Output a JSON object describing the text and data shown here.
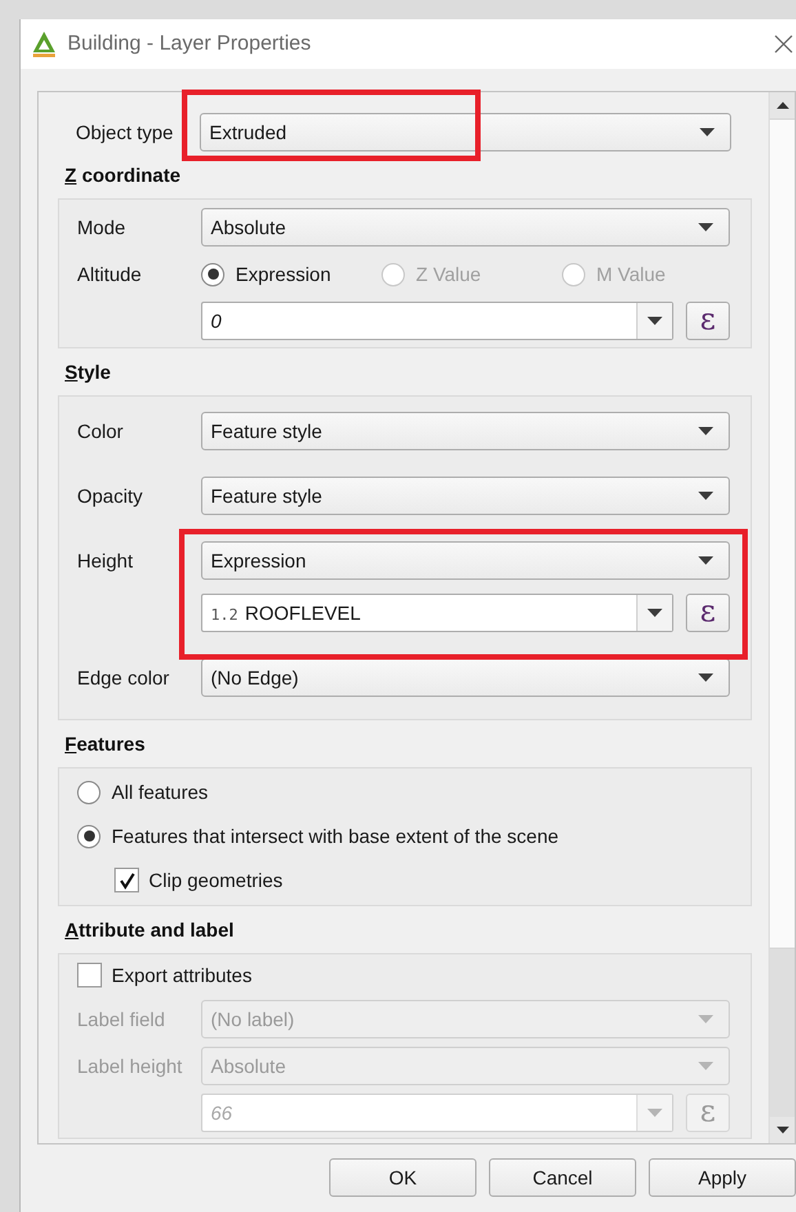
{
  "window": {
    "title": "Building - Layer Properties"
  },
  "object_type": {
    "label": "Object type",
    "value": "Extruded"
  },
  "sections": [
    {
      "title": "Z coordinate",
      "rows": [
        {
          "kind": "combo",
          "label": "Mode",
          "value": "Absolute",
          "disabled": false
        },
        {
          "kind": "radios",
          "label": "Altitude",
          "options": [
            {
              "label": "Expression",
              "selected": true,
              "disabled": false
            },
            {
              "label": "Z Value",
              "selected": false,
              "disabled": true
            },
            {
              "label": "M Value",
              "selected": false,
              "disabled": true
            }
          ]
        },
        {
          "kind": "expression",
          "value": "0",
          "button": "ε",
          "disabled": false
        }
      ]
    },
    {
      "title": "Style",
      "rows": [
        {
          "kind": "combo",
          "label": "Color",
          "value": "Feature style",
          "disabled": false
        },
        {
          "kind": "combo",
          "label": "Opacity",
          "value": "Feature style",
          "disabled": false
        },
        {
          "kind": "combo",
          "label": "Height",
          "value": "Expression",
          "disabled": false
        },
        {
          "kind": "expression",
          "prefix": "1.2",
          "value": "ROOFLEVEL",
          "button": "ε",
          "disabled": false
        },
        {
          "kind": "combo",
          "label": "Edge color",
          "value": "(No Edge)",
          "disabled": false
        }
      ]
    },
    {
      "title": "Features",
      "rows": [
        {
          "kind": "radio",
          "label": "All features",
          "selected": false
        },
        {
          "kind": "radio",
          "label": "Features that intersect with base extent of the scene",
          "selected": true,
          "children": [
            {
              "kind": "checkbox",
              "label": "Clip geometries",
              "checked": true
            }
          ]
        }
      ]
    },
    {
      "title": "Attribute and label",
      "rows": [
        {
          "kind": "checkbox",
          "label": "Export attributes",
          "checked": false
        },
        {
          "kind": "combo",
          "label": "Label field",
          "value": "(No label)",
          "disabled": true
        },
        {
          "kind": "combo",
          "label": "Label height",
          "value": "Absolute",
          "disabled": true
        },
        {
          "kind": "expression",
          "value": "66",
          "button": "ε",
          "disabled": true
        }
      ]
    }
  ],
  "buttons": [
    "OK",
    "Cancel",
    "Apply"
  ]
}
